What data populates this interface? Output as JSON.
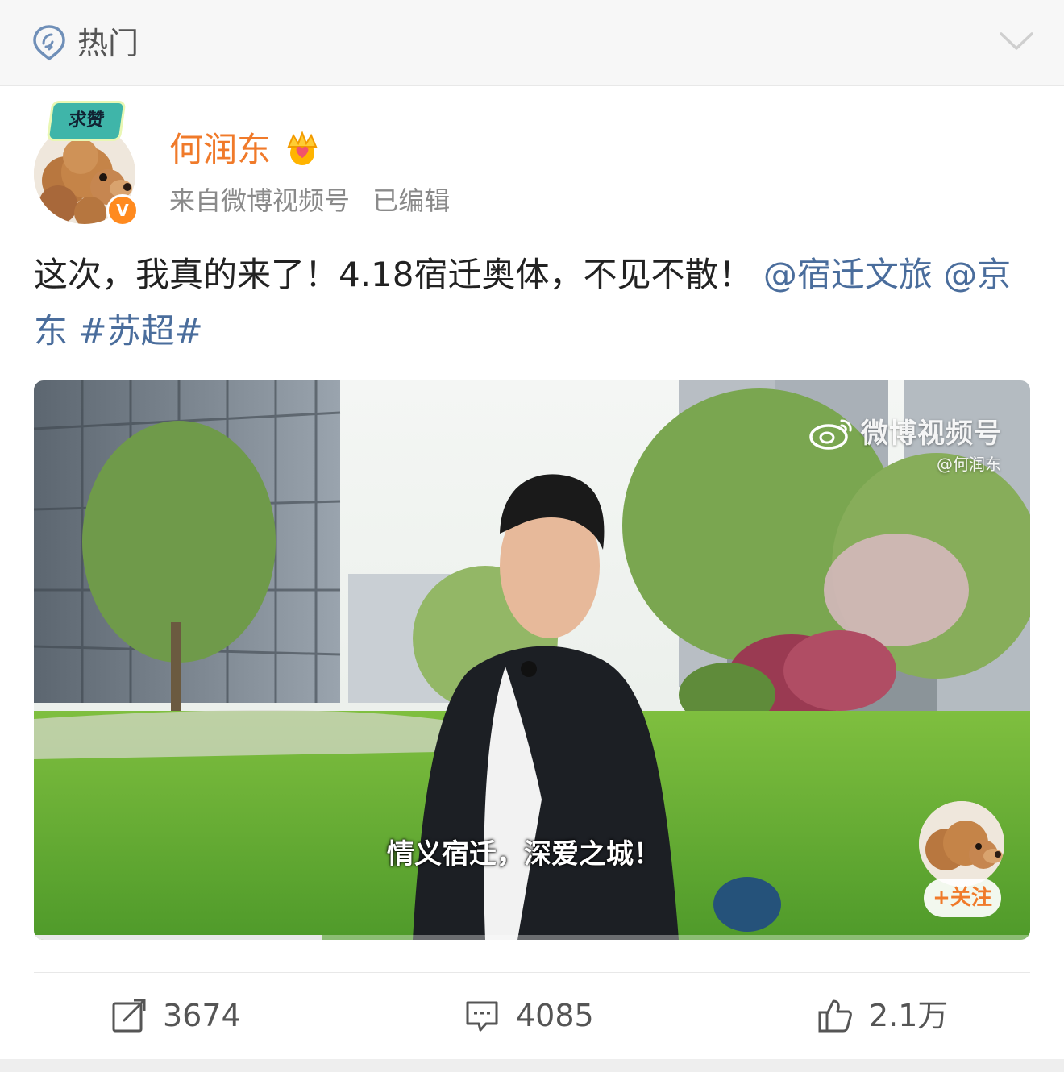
{
  "header": {
    "title": "热门",
    "hot_icon": "hot-pin-icon",
    "collapse_icon": "chevron-down-icon"
  },
  "post": {
    "author": {
      "name": "何润东",
      "avatar_badge": "求赞",
      "verified_mark": "V",
      "source": "来自微博视频号",
      "edited": "已编辑"
    },
    "text": {
      "body": "这次，我真的来了！4.18宿迁奥体，不见不散！ ",
      "mention_1": "@宿迁文旅",
      "mention_2": "@京东",
      "hashtag": "#苏超#"
    },
    "video": {
      "watermark_title": "微博视频号",
      "watermark_handle": "@何润东",
      "subtitle": "情义宿迁，深爱之城！",
      "follow_label": "+关注",
      "progress": 0.29
    },
    "actions": {
      "repost_count": "3674",
      "comment_count": "4085",
      "like_count": "2.1万"
    }
  },
  "colors": {
    "name": "#f07a2a",
    "link": "#4a6d9c",
    "verify": "#ff8a1f"
  }
}
